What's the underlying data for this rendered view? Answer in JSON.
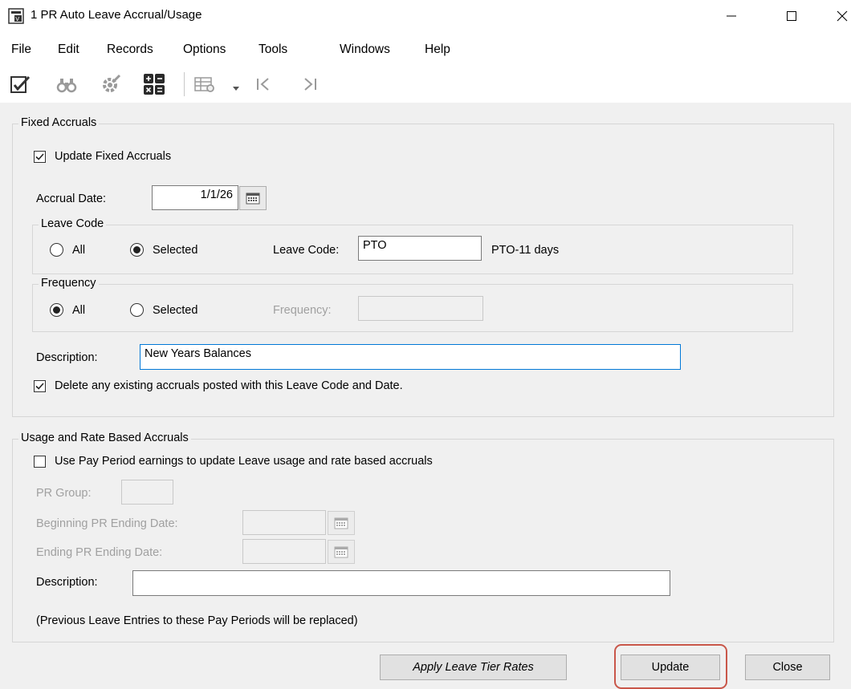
{
  "window": {
    "title": "1 PR Auto Leave Accrual/Usage"
  },
  "menu": [
    "File",
    "Edit",
    "Records",
    "Options",
    "Tools",
    "Windows",
    "Help"
  ],
  "toolbar": {
    "icons": [
      "checklist-icon",
      "binoculars-icon",
      "gear-icon",
      "calculator-icon",
      "grid-settings-icon",
      "first-record-icon",
      "last-record-icon"
    ]
  },
  "fixed": {
    "legend": "Fixed Accruals",
    "update_label": "Update Fixed Accruals",
    "update_checked": true,
    "accrual_date_label": "Accrual Date:",
    "accrual_date_value": "1/1/26",
    "leave_code_group": "Leave Code",
    "leave_all": "All",
    "leave_selected": "Selected",
    "leave_selection": "Selected",
    "leave_code_label": "Leave Code:",
    "leave_code_value": "PTO",
    "leave_code_desc": "PTO-11 days",
    "frequency_group": "Frequency",
    "freq_all": "All",
    "freq_selected": "Selected",
    "freq_selection": "All",
    "frequency_label": "Frequency:",
    "frequency_value": "",
    "description_label": "Description:",
    "description_value": "New Years Balances",
    "delete_label": "Delete any existing accruals posted with this Leave Code and Date.",
    "delete_checked": true
  },
  "usage": {
    "legend": "Usage and Rate Based Accruals",
    "use_label": "Use Pay Period earnings to update Leave usage and rate based accruals",
    "use_checked": false,
    "pr_group_label": "PR Group:",
    "pr_group_value": "",
    "begin_label": "Beginning PR Ending Date:",
    "begin_value": "",
    "end_label": "Ending PR Ending Date:",
    "end_value": "",
    "description_label": "Description:",
    "description_value": "",
    "note": "(Previous Leave Entries to these Pay Periods will be replaced)"
  },
  "buttons": {
    "apply": "Apply Leave Tier Rates",
    "update": "Update",
    "close": "Close"
  },
  "colors": {
    "highlight": "#c9574a",
    "focus": "#0078d7"
  }
}
